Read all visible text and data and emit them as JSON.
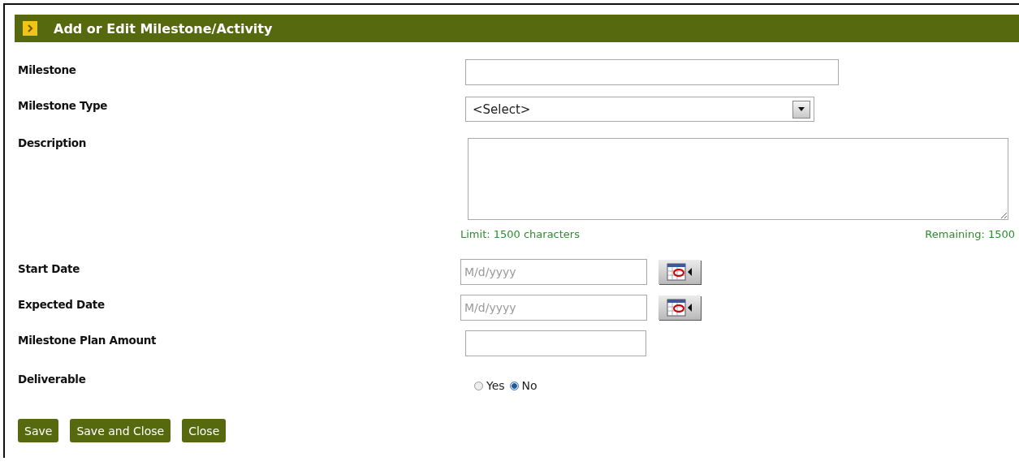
{
  "header": {
    "title": "Add or Edit Milestone/Activity"
  },
  "fields": [
    {
      "kind": "text",
      "label": "Milestone"
    },
    {
      "kind": "select",
      "label": "Milestone Type",
      "value": "<Select>"
    },
    {
      "kind": "textarea",
      "label": "Description",
      "limit": "Limit: 1500 characters",
      "remaining": "Remaining: 1500"
    },
    {
      "kind": "date",
      "label": "Start Date",
      "placeholder": "M/d/yyyy"
    },
    {
      "kind": "date",
      "label": "Expected Date",
      "placeholder": "M/d/yyyy"
    },
    {
      "kind": "amount",
      "label": "Milestone Plan Amount"
    },
    {
      "kind": "radio",
      "label": "Deliverable",
      "options": [
        {
          "label": "Yes",
          "selected": false
        },
        {
          "label": "No",
          "selected": true
        }
      ]
    }
  ],
  "buttons": [
    "Save",
    "Save and Close",
    "Close"
  ]
}
